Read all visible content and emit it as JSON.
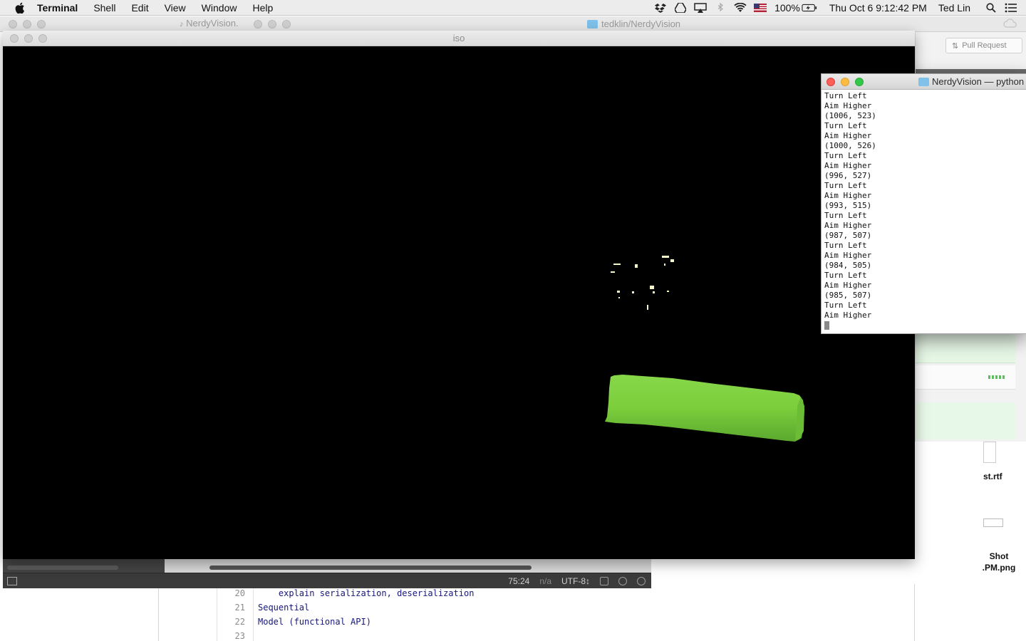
{
  "menubar": {
    "app_name": "Terminal",
    "menus": [
      "Shell",
      "Edit",
      "View",
      "Window",
      "Help"
    ],
    "battery": "100%",
    "datetime": "Thu Oct 6  9:12:42 PM",
    "user": "Ted Lin"
  },
  "background": {
    "file_tab": "NerdyVision.",
    "repo_title": "tedklin/NerdyVision",
    "pull_request_label": "Pull Request"
  },
  "desktop": {
    "file_1": "st.rtf",
    "file_2_line1": "Shot",
    "file_2_line2": ".PM.png"
  },
  "editor": {
    "lines": [
      {
        "num": "20",
        "text": "    explain serialization, deserialization"
      },
      {
        "num": "21",
        "text": "Sequential"
      },
      {
        "num": "22",
        "text": "Model (functional API)"
      },
      {
        "num": "23",
        "text": ""
      }
    ]
  },
  "statusbar": {
    "position": "75:24",
    "na": "n/a",
    "encoding": "UTF-8↕"
  },
  "iso_window": {
    "title": "iso"
  },
  "terminal": {
    "title": "NerdyVision — python",
    "lines": [
      "Turn Left",
      "Aim Higher",
      "(1006, 523)",
      "Turn Left",
      "Aim Higher",
      "(1000, 526)",
      "Turn Left",
      "Aim Higher",
      "(996, 527)",
      "Turn Left",
      "Aim Higher",
      "(993, 515)",
      "Turn Left",
      "Aim Higher",
      "(987, 507)",
      "Turn Left",
      "Aim Higher",
      "(984, 505)",
      "Turn Left",
      "Aim Higher",
      "(985, 507)",
      "Turn Left",
      "Aim Higher"
    ]
  },
  "colors": {
    "green_target": "#7cce3c",
    "close": "#fc605b",
    "minimize": "#fdbc40",
    "maximize": "#34c84a"
  }
}
